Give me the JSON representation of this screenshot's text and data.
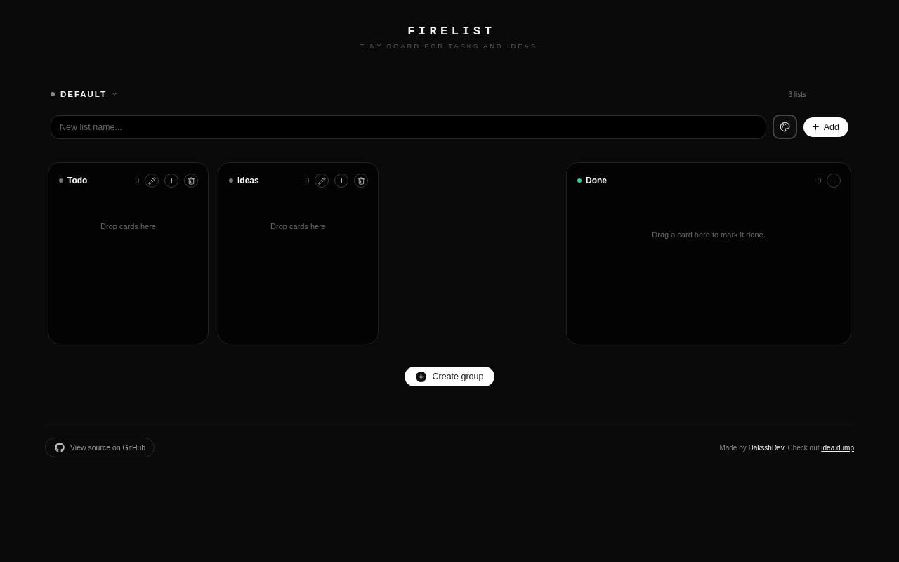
{
  "header": {
    "title": "FIRELIST",
    "subtitle": "TINY BOARD FOR TASKS AND IDEAS."
  },
  "group": {
    "name": "DEFAULT",
    "list_count": "3 lists"
  },
  "new_list": {
    "placeholder": "New list name...",
    "add_button": "Add"
  },
  "lists": [
    {
      "kind": "regular",
      "name": "Todo",
      "color": "#737373",
      "count": "0",
      "empty_text": "Drop cards here"
    },
    {
      "kind": "regular",
      "name": "Ideas",
      "color": "#737373",
      "count": "0",
      "empty_text": "Drop cards here"
    },
    {
      "kind": "done",
      "name": "Done",
      "color": "#34d399",
      "count": "0",
      "empty_text": "Drag a card here to mark it done."
    }
  ],
  "create_group_button": "Create group",
  "footer": {
    "source_link": "View source on GitHub",
    "credit": {
      "prefix": "Made by",
      "author": "DaksshDev",
      "middle": ". Check out",
      "link": "idea.dump"
    }
  }
}
